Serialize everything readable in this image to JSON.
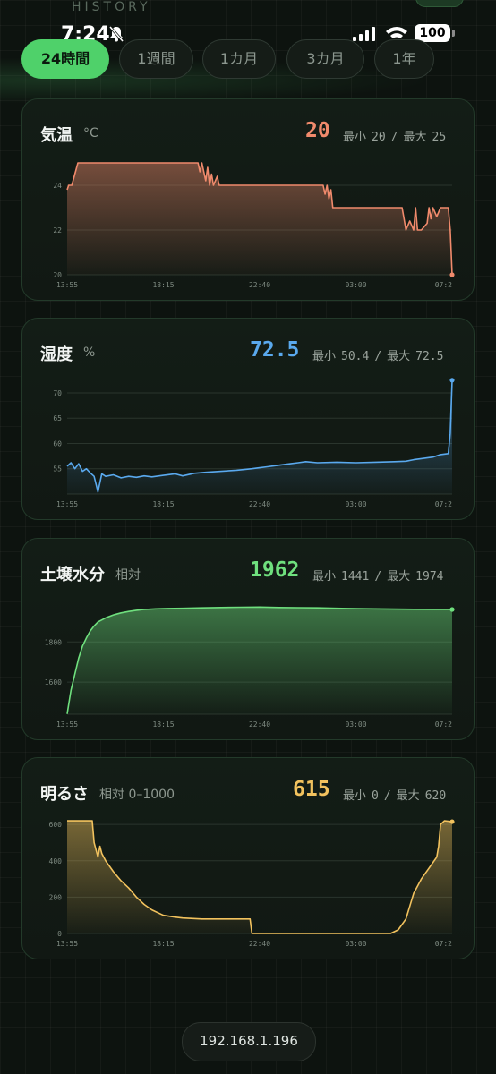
{
  "status": {
    "time": "7:24",
    "battery": "100"
  },
  "header": {
    "label": "HISTORY"
  },
  "tabs": [
    "24時間",
    "1週間",
    "1カ月",
    "3カ月",
    "1年"
  ],
  "active_tab": 0,
  "colors": {
    "temp": "#f08a6c",
    "humidity": "#5aa9ee",
    "soil": "#6fe07e",
    "light": "#f2c25e",
    "accent": "#4fd16a"
  },
  "cards": [
    {
      "title": "気温",
      "unit": "°C",
      "value": "20",
      "min_label": "最小",
      "min": "20",
      "sep": "/",
      "max_label": "最大",
      "max": "25"
    },
    {
      "title": "湿度",
      "unit": "%",
      "value": "72.5",
      "min_label": "最小",
      "min": "50.4",
      "sep": "/",
      "max_label": "最大",
      "max": "72.5"
    },
    {
      "title": "土壌水分",
      "unit": "相対",
      "value": "1962",
      "min_label": "最小",
      "min": "1441",
      "sep": "/",
      "max_label": "最大",
      "max": "1974"
    },
    {
      "title": "明るさ",
      "unit": "相対 0–1000",
      "value": "615",
      "min_label": "最小",
      "min": "0",
      "sep": "/",
      "max_label": "最大",
      "max": "620"
    }
  ],
  "chart_data": [
    {
      "type": "area",
      "x_ticks": [
        "13:55",
        "18:15",
        "22:40",
        "03:00",
        "07:2"
      ],
      "y_ticks": [
        "24",
        "22",
        "20"
      ],
      "ylim": [
        20,
        25.2
      ],
      "grid": true,
      "x": [
        0,
        0.004,
        0.012,
        0.028,
        0.34,
        0.345,
        0.35,
        0.36,
        0.365,
        0.37,
        0.375,
        0.38,
        0.39,
        0.395,
        0.4,
        0.405,
        0.41,
        0.665,
        0.67,
        0.675,
        0.68,
        0.685,
        0.69,
        0.695,
        0.87,
        0.875,
        0.88,
        0.89,
        0.9,
        0.905,
        0.91,
        0.92,
        0.935,
        0.94,
        0.945,
        0.95,
        0.96,
        0.97,
        0.975,
        0.99,
        0.995,
        1.0
      ],
      "y": [
        23.8,
        24.0,
        24.0,
        25.0,
        25.0,
        24.6,
        25.0,
        24.2,
        24.8,
        24.0,
        24.5,
        24.0,
        24.4,
        24.0,
        24.0,
        24.0,
        24.0,
        24.0,
        23.6,
        24.0,
        23.4,
        23.8,
        23.0,
        23.0,
        23.0,
        22.5,
        22.0,
        22.4,
        22.0,
        23.0,
        22.0,
        22.0,
        22.3,
        23.0,
        22.5,
        23.0,
        22.6,
        23.0,
        23.0,
        23.0,
        22.0,
        20.0
      ]
    },
    {
      "type": "area",
      "x_ticks": [
        "13:55",
        "18:15",
        "22:40",
        "03:00",
        "07:2"
      ],
      "y_ticks": [
        "70",
        "65",
        "60",
        "55"
      ],
      "ylim": [
        50.0,
        73.0
      ],
      "grid": true,
      "x": [
        0,
        0.01,
        0.02,
        0.03,
        0.04,
        0.05,
        0.06,
        0.07,
        0.08,
        0.09,
        0.1,
        0.12,
        0.14,
        0.16,
        0.18,
        0.2,
        0.22,
        0.25,
        0.28,
        0.3,
        0.33,
        0.36,
        0.4,
        0.44,
        0.48,
        0.5,
        0.52,
        0.54,
        0.56,
        0.58,
        0.6,
        0.62,
        0.65,
        0.7,
        0.75,
        0.8,
        0.85,
        0.88,
        0.9,
        0.92,
        0.95,
        0.97,
        0.99,
        0.995,
        1.0
      ],
      "y": [
        55.5,
        56.2,
        55.0,
        56.0,
        54.5,
        55.0,
        54.2,
        53.5,
        50.4,
        54.0,
        53.5,
        53.8,
        53.2,
        53.5,
        53.3,
        53.6,
        53.4,
        53.7,
        54.0,
        53.6,
        54.1,
        54.3,
        54.5,
        54.7,
        55.0,
        55.2,
        55.4,
        55.6,
        55.8,
        56.0,
        56.2,
        56.4,
        56.2,
        56.3,
        56.2,
        56.3,
        56.4,
        56.5,
        56.8,
        57.0,
        57.3,
        57.8,
        58.0,
        62.0,
        72.5
      ]
    },
    {
      "type": "area",
      "x_ticks": [
        "13:55",
        "18:15",
        "22:40",
        "03:00",
        "07:2"
      ],
      "y_ticks": [
        "1800",
        "1600"
      ],
      "ylim": [
        1440,
        2020
      ],
      "grid": true,
      "x": [
        0,
        0.005,
        0.01,
        0.02,
        0.03,
        0.04,
        0.05,
        0.06,
        0.07,
        0.08,
        0.1,
        0.12,
        0.14,
        0.16,
        0.18,
        0.2,
        0.23,
        0.26,
        0.3,
        0.35,
        0.4,
        0.45,
        0.5,
        0.55,
        0.6,
        0.65,
        0.7,
        0.75,
        0.8,
        0.85,
        0.9,
        0.95,
        1.0
      ],
      "y": [
        1441,
        1500,
        1560,
        1640,
        1720,
        1780,
        1820,
        1855,
        1880,
        1900,
        1920,
        1935,
        1945,
        1952,
        1958,
        1962,
        1965,
        1967,
        1968,
        1970,
        1972,
        1973,
        1974,
        1972,
        1971,
        1970,
        1968,
        1966,
        1965,
        1964,
        1963,
        1962,
        1962
      ]
    },
    {
      "type": "area",
      "x_ticks": [
        "13:55",
        "18:15",
        "22:40",
        "03:00",
        "07:2"
      ],
      "y_ticks": [
        "600",
        "400",
        "200",
        "0"
      ],
      "ylim": [
        0,
        640
      ],
      "grid": true,
      "x": [
        0,
        0.065,
        0.07,
        0.08,
        0.085,
        0.09,
        0.1,
        0.12,
        0.14,
        0.16,
        0.18,
        0.2,
        0.22,
        0.25,
        0.28,
        0.3,
        0.35,
        0.4,
        0.45,
        0.475,
        0.48,
        0.5,
        0.6,
        0.7,
        0.8,
        0.84,
        0.86,
        0.88,
        0.9,
        0.92,
        0.94,
        0.96,
        0.965,
        0.97,
        0.98,
        1.0
      ],
      "y": [
        620,
        620,
        500,
        420,
        480,
        440,
        400,
        340,
        290,
        250,
        200,
        160,
        130,
        100,
        90,
        85,
        80,
        80,
        80,
        80,
        0,
        0,
        0,
        0,
        0,
        0,
        20,
        80,
        220,
        300,
        360,
        420,
        480,
        600,
        620,
        615
      ]
    }
  ],
  "footer": {
    "ip": "192.168.1.196"
  }
}
